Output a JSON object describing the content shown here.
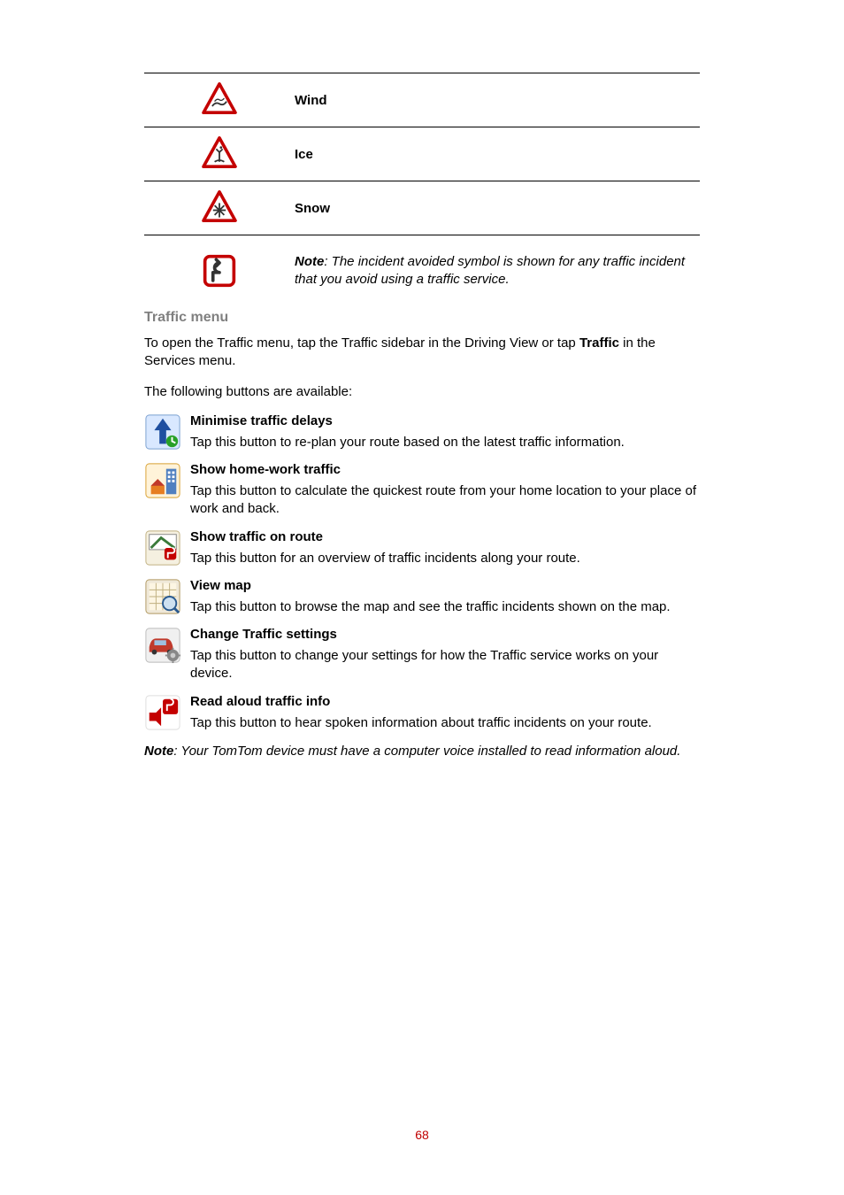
{
  "weather_rows": [
    {
      "label": "Wind",
      "icon": "wind"
    },
    {
      "label": "Ice",
      "icon": "ice"
    },
    {
      "label": "Snow",
      "icon": "snow"
    }
  ],
  "note": {
    "bold": "Note",
    "rest": ": The incident avoided symbol is shown for any traffic incident that you avoid using a traffic service."
  },
  "section_title": "Traffic menu",
  "intro": {
    "pre": "To open the Traffic menu, tap the Traffic sidebar in the Driving View or tap ",
    "bold": "Traffic",
    "post": " in the Services menu."
  },
  "intro2": "The following buttons are available:",
  "menu": [
    {
      "icon": "arrow-minimise",
      "title": "Minimise traffic delays",
      "desc": "Tap this button to re-plan your route based on the latest traffic information."
    },
    {
      "icon": "home-work",
      "title": "Show home-work traffic",
      "desc": "Tap this button to calculate the quickest route from your home location to your place of work and back."
    },
    {
      "icon": "traffic-route",
      "title": "Show traffic on route",
      "desc": "Tap this button for an overview of traffic incidents along your route."
    },
    {
      "icon": "view-map",
      "title": "View map",
      "desc": "Tap this button to browse the map and see the traffic incidents shown on the map."
    },
    {
      "icon": "car-settings",
      "title": "Change Traffic settings",
      "desc": "Tap this button to change your settings for how the Traffic service works on your device."
    },
    {
      "icon": "speaker-sign",
      "title": "Read aloud traffic info",
      "desc": "Tap this button to hear spoken information about traffic incidents on your route."
    }
  ],
  "footer_note": {
    "bold": "Note",
    "rest": ": Your TomTom device must have a computer voice installed to read information aloud."
  },
  "page_number": "68"
}
